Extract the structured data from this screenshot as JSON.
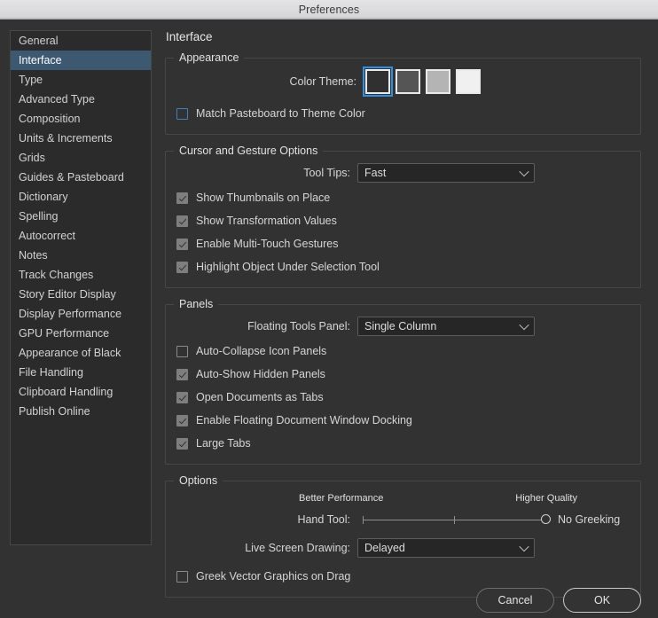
{
  "window": {
    "title": "Preferences"
  },
  "sidebar": {
    "items": [
      {
        "label": "General",
        "selected": false
      },
      {
        "label": "Interface",
        "selected": true
      },
      {
        "label": "Type",
        "selected": false
      },
      {
        "label": "Advanced Type",
        "selected": false
      },
      {
        "label": "Composition",
        "selected": false
      },
      {
        "label": "Units & Increments",
        "selected": false
      },
      {
        "label": "Grids",
        "selected": false
      },
      {
        "label": "Guides & Pasteboard",
        "selected": false
      },
      {
        "label": "Dictionary",
        "selected": false
      },
      {
        "label": "Spelling",
        "selected": false
      },
      {
        "label": "Autocorrect",
        "selected": false
      },
      {
        "label": "Notes",
        "selected": false
      },
      {
        "label": "Track Changes",
        "selected": false
      },
      {
        "label": "Story Editor Display",
        "selected": false
      },
      {
        "label": "Display Performance",
        "selected": false
      },
      {
        "label": "GPU Performance",
        "selected": false
      },
      {
        "label": "Appearance of Black",
        "selected": false
      },
      {
        "label": "File Handling",
        "selected": false
      },
      {
        "label": "Clipboard Handling",
        "selected": false
      },
      {
        "label": "Publish Online",
        "selected": false
      }
    ]
  },
  "pane": {
    "title": "Interface",
    "appearance": {
      "legend": "Appearance",
      "color_theme_label": "Color Theme:",
      "swatches": [
        {
          "name": "dark",
          "color": "#303030",
          "selected": true
        },
        {
          "name": "medium-dark",
          "color": "#555555",
          "selected": false
        },
        {
          "name": "light-gray",
          "color": "#b4b4b4",
          "selected": false
        },
        {
          "name": "light",
          "color": "#f0f0f0",
          "selected": false
        }
      ],
      "match_pasteboard": {
        "label": "Match Pasteboard to Theme Color",
        "checked": false
      }
    },
    "cursor": {
      "legend": "Cursor and Gesture Options",
      "tool_tips_label": "Tool Tips:",
      "tool_tips_value": "Fast",
      "checkboxes": [
        {
          "label": "Show Thumbnails on Place",
          "checked": true
        },
        {
          "label": "Show Transformation Values",
          "checked": true
        },
        {
          "label": "Enable Multi-Touch Gestures",
          "checked": true
        },
        {
          "label": "Highlight Object Under Selection Tool",
          "checked": true
        }
      ]
    },
    "panels": {
      "legend": "Panels",
      "floating_tools_label": "Floating Tools Panel:",
      "floating_tools_value": "Single Column",
      "checkboxes": [
        {
          "label": "Auto-Collapse Icon Panels",
          "checked": false
        },
        {
          "label": "Auto-Show Hidden Panels",
          "checked": true
        },
        {
          "label": "Open Documents as Tabs",
          "checked": true
        },
        {
          "label": "Enable Floating Document Window Docking",
          "checked": true
        },
        {
          "label": "Large Tabs",
          "checked": true
        }
      ]
    },
    "options": {
      "legend": "Options",
      "hand_tool_label": "Hand Tool:",
      "slider_left_label": "Better Performance",
      "slider_right_label": "Higher Quality",
      "slider_value_label": "No Greeking",
      "slider_position_percent": 100,
      "live_screen_label": "Live Screen Drawing:",
      "live_screen_value": "Delayed",
      "greek_vector": {
        "label": "Greek Vector Graphics on Drag",
        "checked": false
      }
    }
  },
  "buttons": {
    "cancel": "Cancel",
    "ok": "OK"
  },
  "colors": {
    "accent": "#2f8fe0",
    "selection": "#3d5871",
    "window_bg": "#323232",
    "sidebar_bg": "#2b2b2b"
  }
}
